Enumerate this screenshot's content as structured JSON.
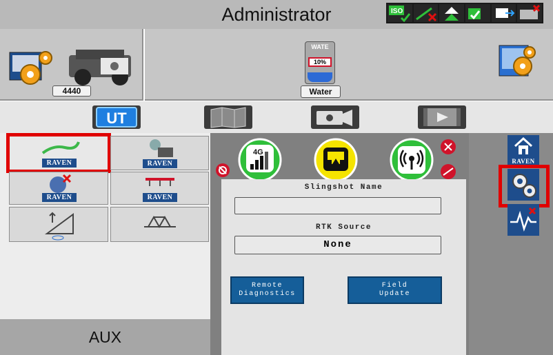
{
  "header": {
    "title": "Administrator"
  },
  "status_icons": [
    "iso-ok-icon",
    "signal-error-icon",
    "guidance-up-icon",
    "map-ok-icon",
    "export-icon",
    "device-error-icon"
  ],
  "vehicle": {
    "label": "4440"
  },
  "product": {
    "tank_name_short": "WATE",
    "percent": "10%",
    "label": "Water"
  },
  "nav_tabs": [
    "ut-tab",
    "map-tab",
    "camera-tab",
    "video-tab"
  ],
  "left_grid": {
    "badge": "RAVEN",
    "items": [
      "boom-control",
      "valve-control",
      "guidance-error",
      "spray-boom",
      "boom-height",
      "boom-frame"
    ]
  },
  "aux": {
    "label": "AUX"
  },
  "slingshot": {
    "name_label": "Slingshot Name",
    "name_value": "",
    "rtk_label": "RTK Source",
    "rtk_value": "None",
    "cellular_label": "4G",
    "remote_diag_label_1": "Remote",
    "remote_diag_label_2": "Diagnostics",
    "field_update_label_1": "Field",
    "field_update_label_2": "Update"
  },
  "sidebar": {
    "home_badge": "RAVEN"
  },
  "colors": {
    "highlight": "#e00000",
    "raven_blue": "#1e4d8c",
    "action_blue": "#155e99",
    "status_green": "#2fbf3a",
    "status_yellow": "#f5e400",
    "error_red": "#d0132a"
  }
}
